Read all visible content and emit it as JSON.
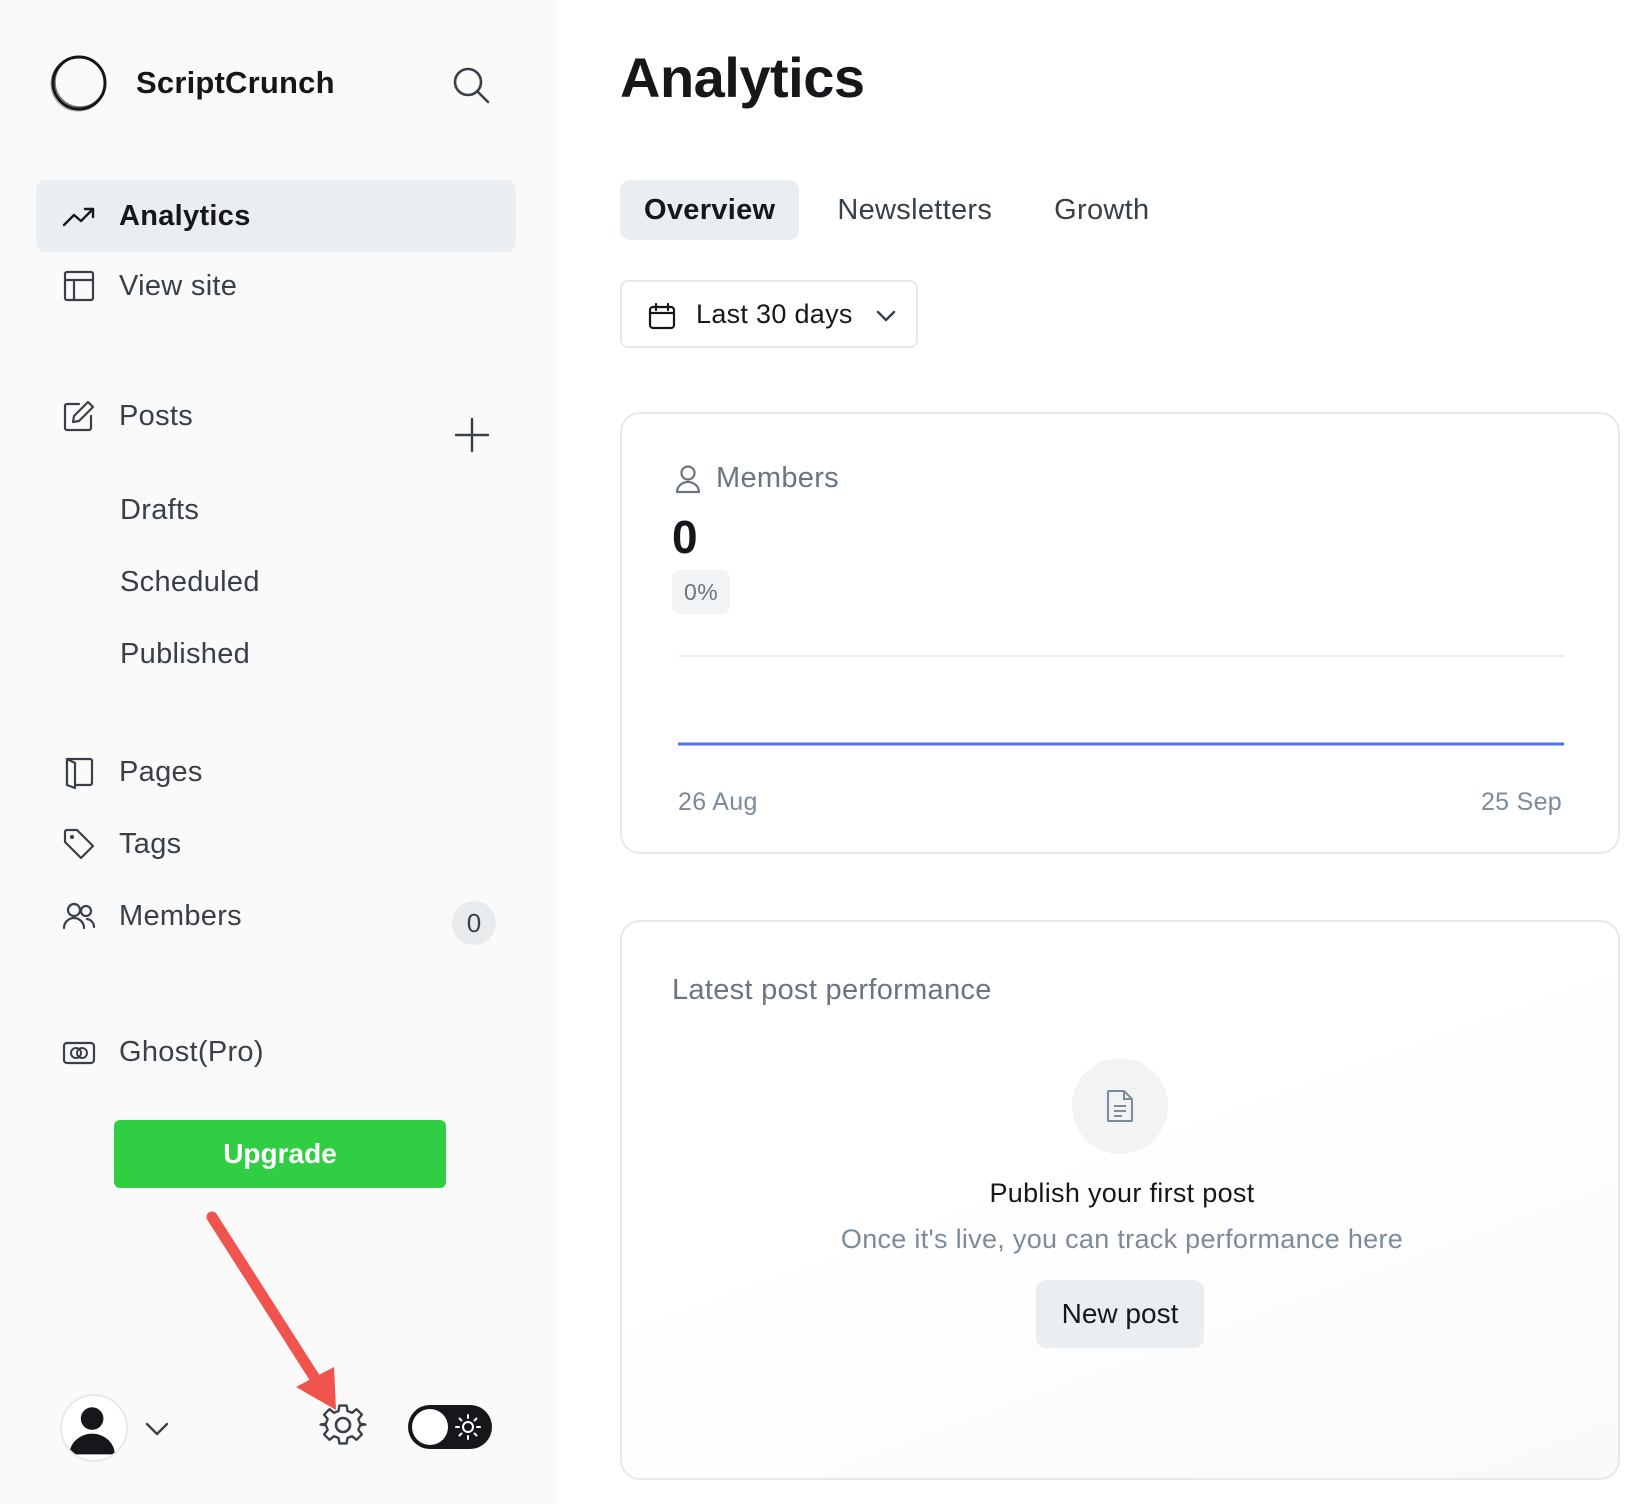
{
  "brand": {
    "name": "ScriptCrunch",
    "logo_icon": "circle-logo-icon"
  },
  "sidebar": {
    "nav_top": [
      {
        "label": "Analytics",
        "icon": "trending-up-icon",
        "active": true
      },
      {
        "label": "View site",
        "icon": "layout-icon",
        "active": false
      }
    ],
    "posts": {
      "label": "Posts",
      "icon": "edit-icon",
      "subitems": [
        "Drafts",
        "Scheduled",
        "Published"
      ]
    },
    "nav_more": [
      {
        "label": "Pages",
        "icon": "pages-icon"
      },
      {
        "label": "Tags",
        "icon": "tag-icon"
      },
      {
        "label": "Members",
        "icon": "members-icon",
        "count": "0"
      }
    ],
    "ghost_pro": {
      "label": "Ghost(Pro)",
      "icon": "ghost-pro-icon"
    },
    "upgrade_label": "Upgrade",
    "theme": "light"
  },
  "main": {
    "title": "Analytics",
    "tabs": [
      {
        "label": "Overview",
        "active": true
      },
      {
        "label": "Newsletters",
        "active": false
      },
      {
        "label": "Growth",
        "active": false
      }
    ],
    "date_range": "Last 30 days",
    "members_card": {
      "label": "Members",
      "value": "0",
      "delta": "0%",
      "x_start": "26 Aug",
      "x_end": "25 Sep"
    },
    "latest_card": {
      "title": "Latest post performance",
      "empty_title": "Publish your first post",
      "empty_subtitle": "Once it's live, you can track performance here",
      "button_label": "New post"
    }
  },
  "chart_data": {
    "type": "line",
    "x": [
      "26 Aug",
      "25 Sep"
    ],
    "series": [
      {
        "values": [
          0,
          0
        ]
      }
    ],
    "color": "#4f71f0"
  },
  "colors": {
    "upgrade": "#30cf43",
    "annotation_arrow": "#f0544c",
    "line": "#4f71f0"
  }
}
